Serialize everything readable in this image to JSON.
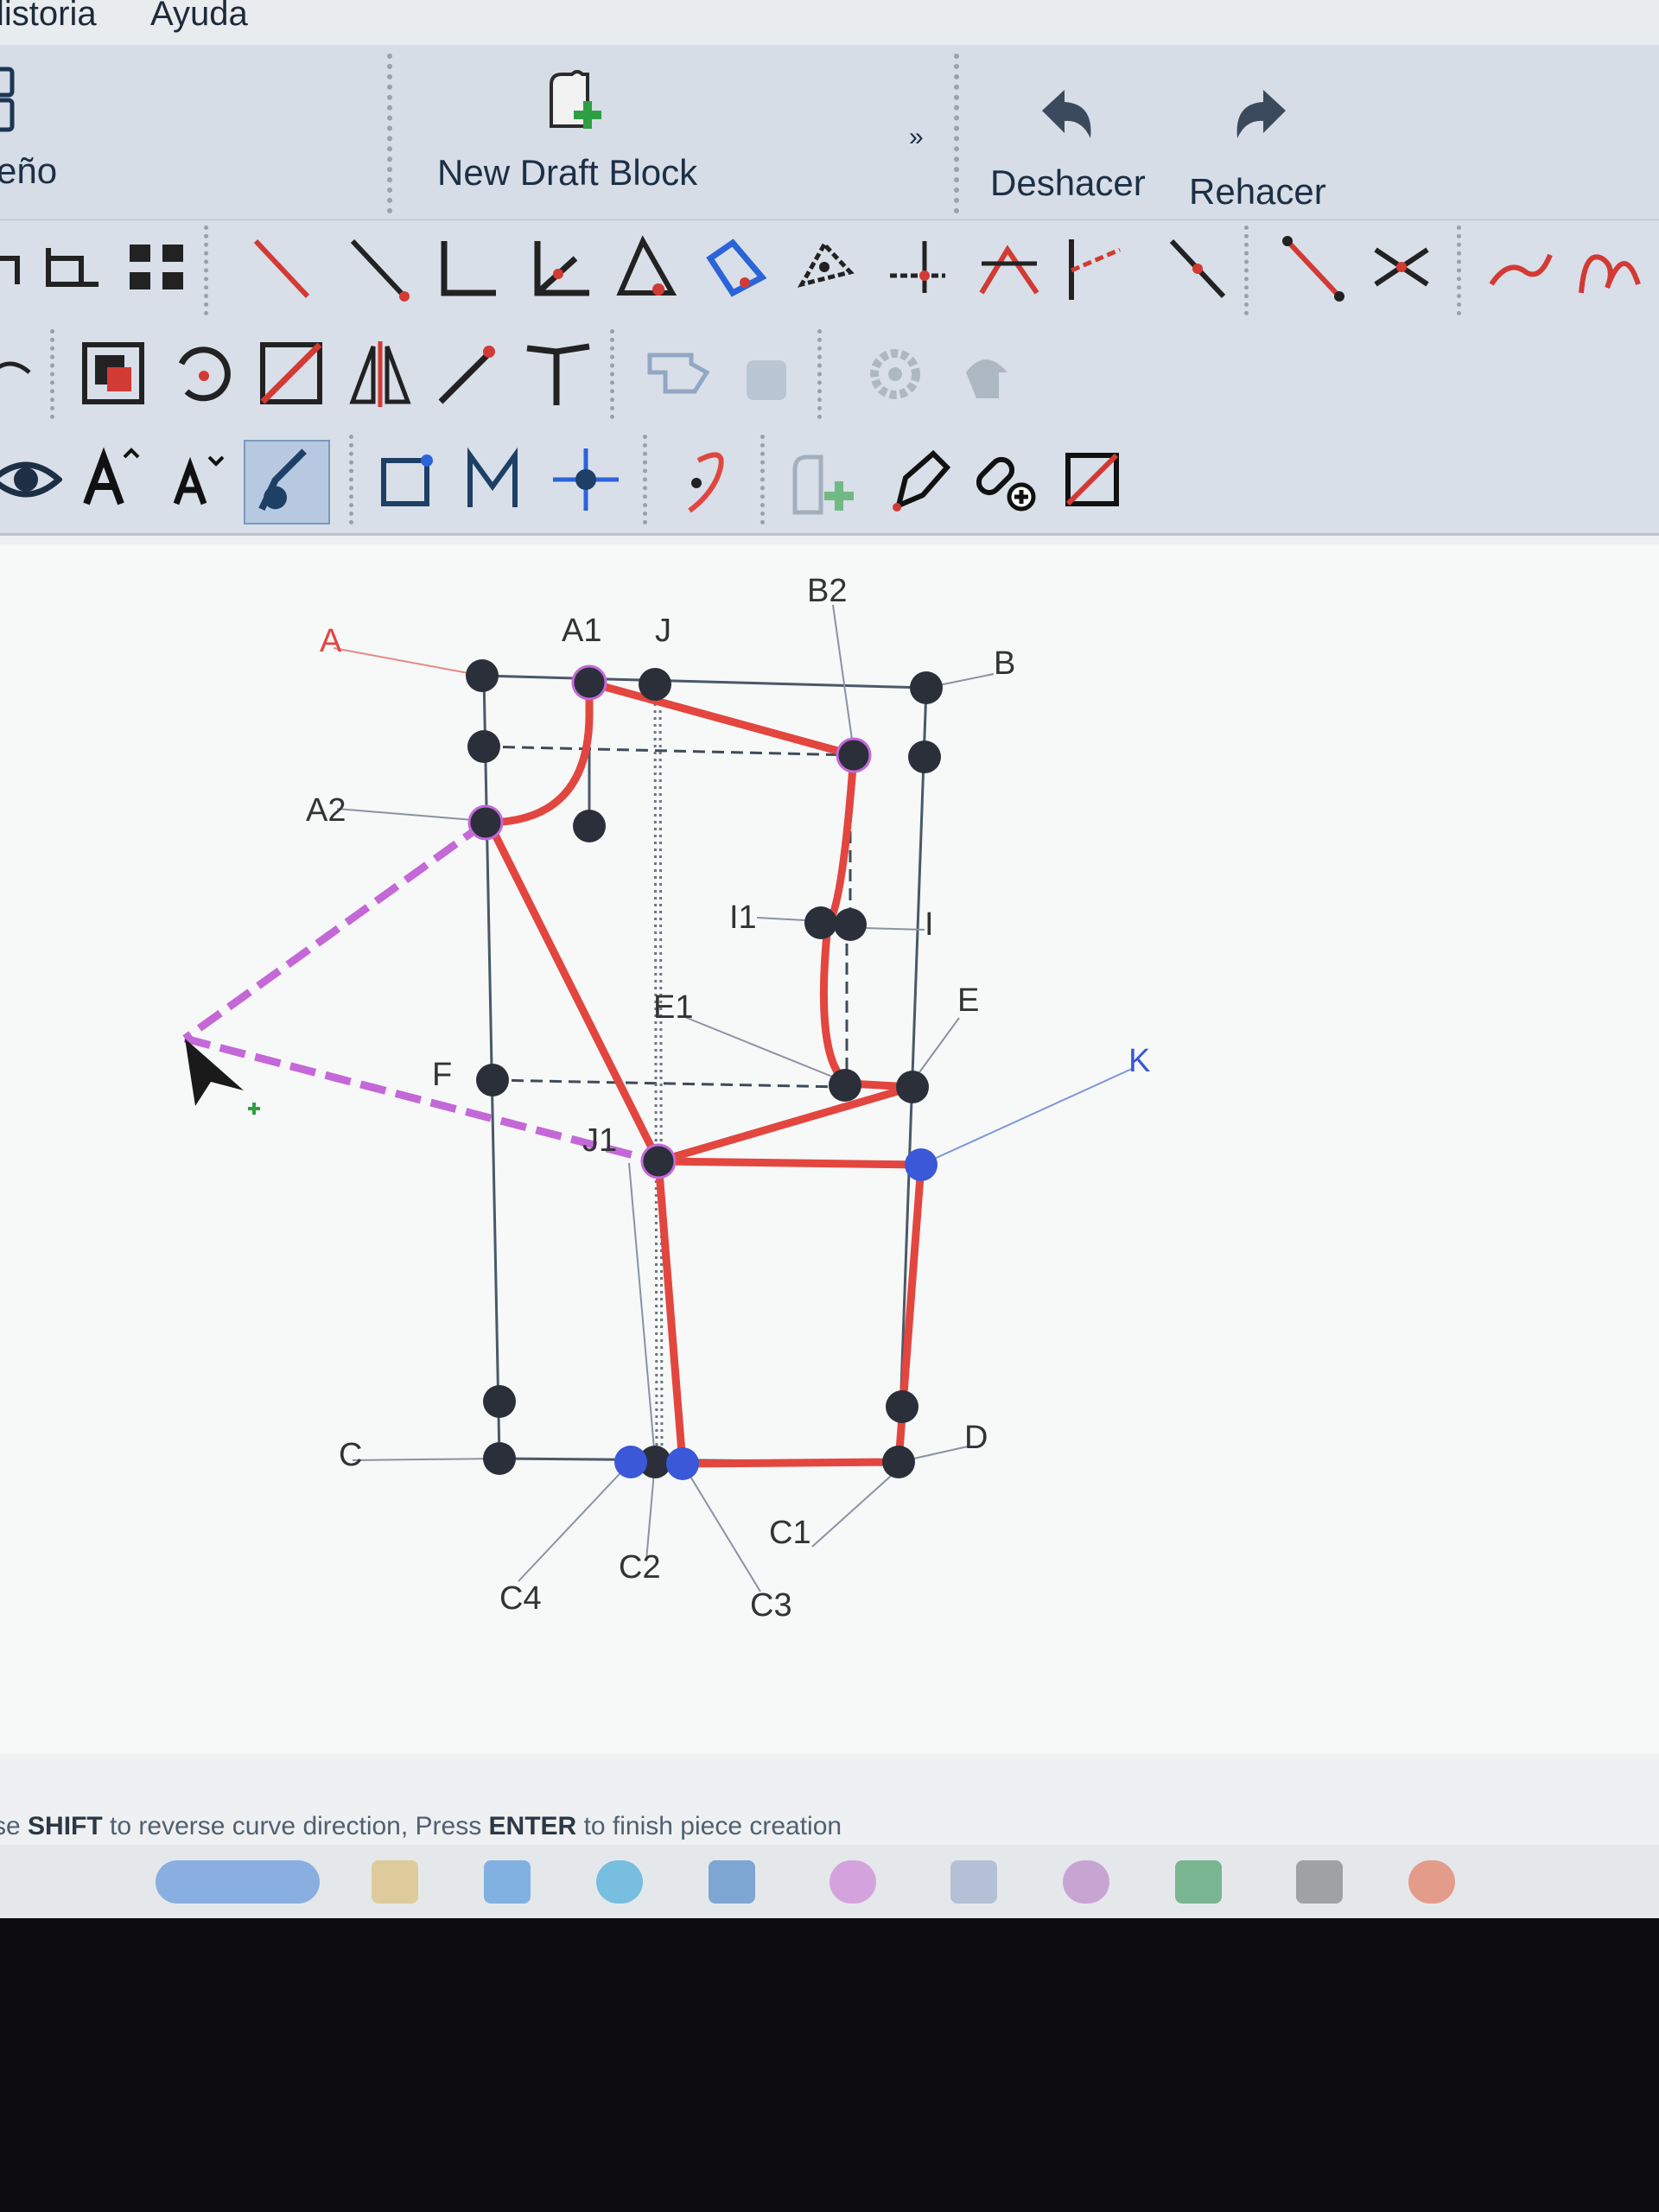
{
  "menu": {
    "items": [
      "listoria",
      "Ayuda"
    ]
  },
  "ribbon": {
    "left_label": "eño",
    "new_draft_block": "New Draft Block",
    "overflow": "»",
    "undo": "Deshacer",
    "redo": "Rehacer"
  },
  "draft": {
    "point_labels": {
      "A": "A",
      "A1": "A1",
      "A2": "A2",
      "J": "J",
      "B": "B",
      "B2": "B2",
      "I1": "I1",
      "I": "I",
      "E1": "E1",
      "E": "E",
      "F": "F",
      "K": "K",
      "J1": "J1",
      "C": "C",
      "D": "D",
      "C1": "C1",
      "C2": "C2",
      "C3": "C3",
      "C4": "C4"
    },
    "colors": {
      "piece": "#e2463f",
      "point": "#2a2f3a",
      "selected": "#3a58d8",
      "preview": "#c468d8"
    }
  },
  "status": {
    "prefix": "se ",
    "key1": "SHIFT",
    "mid": " to reverse curve direction, Press ",
    "key2": "ENTER",
    "suffix": " to finish piece creation"
  },
  "taskbar": {
    "colors": [
      "#3d7fd6",
      "#d9b35a",
      "#2f84d8",
      "#1d9bd8",
      "#2a6fc0",
      "#c66ad2",
      "#8a9fc4",
      "#b06cc0",
      "#1f8a45",
      "#666666",
      "#e25c3a"
    ]
  }
}
